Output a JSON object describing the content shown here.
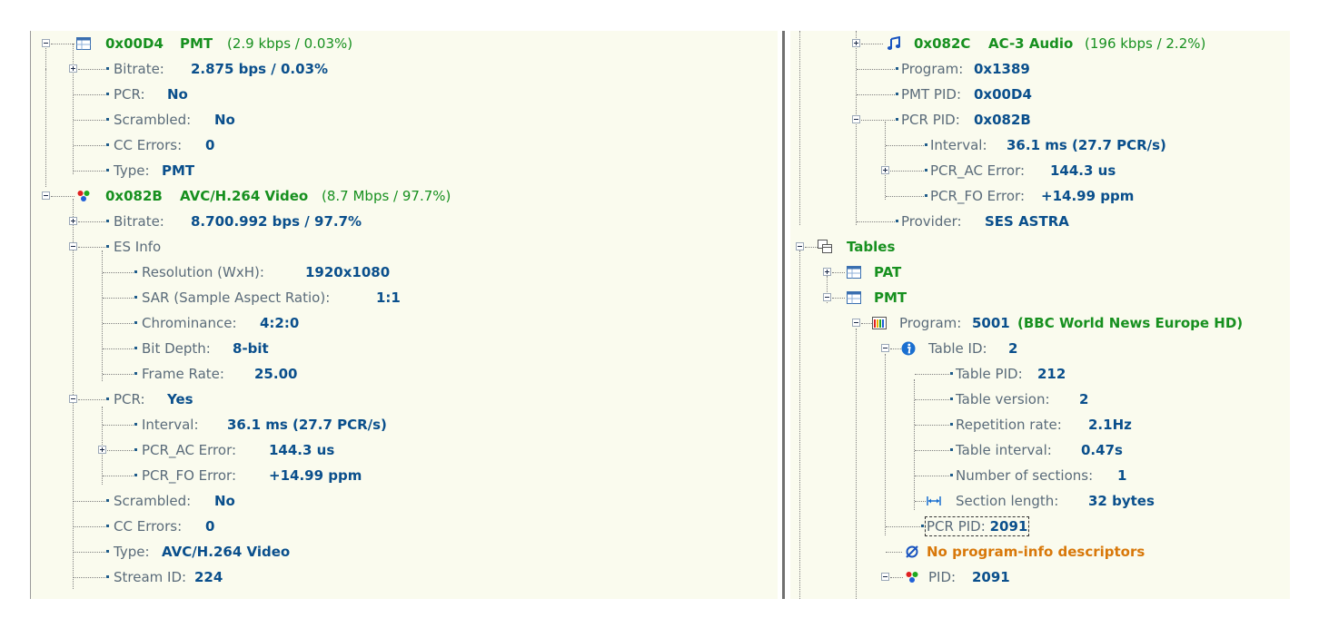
{
  "left_tree": {
    "pmt_stream": {
      "pid": "0x00D4",
      "name": "PMT",
      "rate": "(2.9 kbps / 0.03%)"
    },
    "pmt_bitrate": {
      "label": "Bitrate:",
      "value": "2.875 bps / 0.03%"
    },
    "pmt_pcr": {
      "label": "PCR:",
      "value": "No"
    },
    "pmt_scrambled": {
      "label": "Scrambled:",
      "value": "No"
    },
    "pmt_cc_errors": {
      "label": "CC Errors:",
      "value": "0"
    },
    "pmt_type": {
      "label": "Type:",
      "value": "PMT"
    },
    "video_stream": {
      "pid": "0x082B",
      "name": "AVC/H.264 Video",
      "rate": "(8.7 Mbps / 97.7%)"
    },
    "video_bitrate": {
      "label": "Bitrate:",
      "value": "8.700.992 bps / 97.7%"
    },
    "es_info": {
      "label": "ES Info"
    },
    "resolution": {
      "label": "Resolution (WxH):",
      "value": "1920x1080"
    },
    "sar": {
      "label": "SAR (Sample Aspect Ratio):",
      "value": "1:1"
    },
    "chrominance": {
      "label": "Chrominance:",
      "value": "4:2:0"
    },
    "bit_depth": {
      "label": "Bit Depth:",
      "value": "8-bit"
    },
    "frame_rate": {
      "label": "Frame Rate:",
      "value": "25.00"
    },
    "video_pcr": {
      "label": "PCR:",
      "value": "Yes"
    },
    "video_pcr_interval": {
      "label": "Interval:",
      "value": "36.1 ms (27.7 PCR/s)"
    },
    "video_pcr_ac": {
      "label": "PCR_AC Error:",
      "value": "144.3 us"
    },
    "video_pcr_fo": {
      "label": "PCR_FO Error:",
      "value": "+14.99 ppm"
    },
    "video_scrambled": {
      "label": "Scrambled:",
      "value": "No"
    },
    "video_cc_errors": {
      "label": "CC Errors:",
      "value": "0"
    },
    "video_type": {
      "label": "Type:",
      "value": "AVC/H.264 Video"
    },
    "stream_id": {
      "label": "Stream ID:",
      "value": "224"
    }
  },
  "right_tree": {
    "audio_stream": {
      "pid": "0x082C",
      "name": "AC-3 Audio",
      "rate": "(196 kbps / 2.2%)"
    },
    "program": {
      "label": "Program:",
      "value": "0x1389"
    },
    "pmt_pid": {
      "label": "PMT PID:",
      "value": "0x00D4"
    },
    "pcr_pid": {
      "label": "PCR PID:",
      "value": "0x082B"
    },
    "pcr_interval": {
      "label": "Interval:",
      "value": "36.1 ms (27.7 PCR/s)"
    },
    "pcr_ac": {
      "label": "PCR_AC Error:",
      "value": "144.3 us"
    },
    "pcr_fo": {
      "label": "PCR_FO Error:",
      "value": "+14.99 ppm"
    },
    "provider": {
      "label": "Provider:",
      "value": "SES ASTRA"
    },
    "tables": {
      "label": "Tables"
    },
    "pat": {
      "label": "PAT"
    },
    "pmt": {
      "label": "PMT"
    },
    "pmt_program": {
      "label": "Program:",
      "value": "5001",
      "service": "(BBC World News Europe HD)"
    },
    "table_id": {
      "label": "Table ID:",
      "value": "2"
    },
    "table_pid": {
      "label": "Table PID:",
      "value": "212"
    },
    "table_version": {
      "label": "Table version:",
      "value": "2"
    },
    "repetition_rate": {
      "label": "Repetition rate:",
      "value": "2.1Hz"
    },
    "table_interval": {
      "label": "Table interval:",
      "value": "0.47s"
    },
    "num_sections": {
      "label": "Number of sections:",
      "value": "1"
    },
    "section_length": {
      "label": "Section length:",
      "value": "32 bytes"
    },
    "pcr_pid_2091": {
      "label": "PCR PID:",
      "value": "2091"
    },
    "no_descriptors": {
      "label": "No program-info descriptors"
    },
    "pid_2091": {
      "label": "PID:",
      "value": "2091"
    }
  },
  "colors": {
    "pane_bg": "#fafbee",
    "label_gray": "#5a6b7a",
    "value_blue": "#0a4f8c",
    "stream_green": "#17901f",
    "warning_orange": "#d8780a"
  },
  "icons": {
    "table": "table-icon",
    "video": "video-stream-icon",
    "audio": "audio-note-icon",
    "tables_group": "tables-group-icon",
    "program": "program-icon",
    "info": "info-icon",
    "length": "length-arrow-icon",
    "empty": "empty-set-icon"
  }
}
